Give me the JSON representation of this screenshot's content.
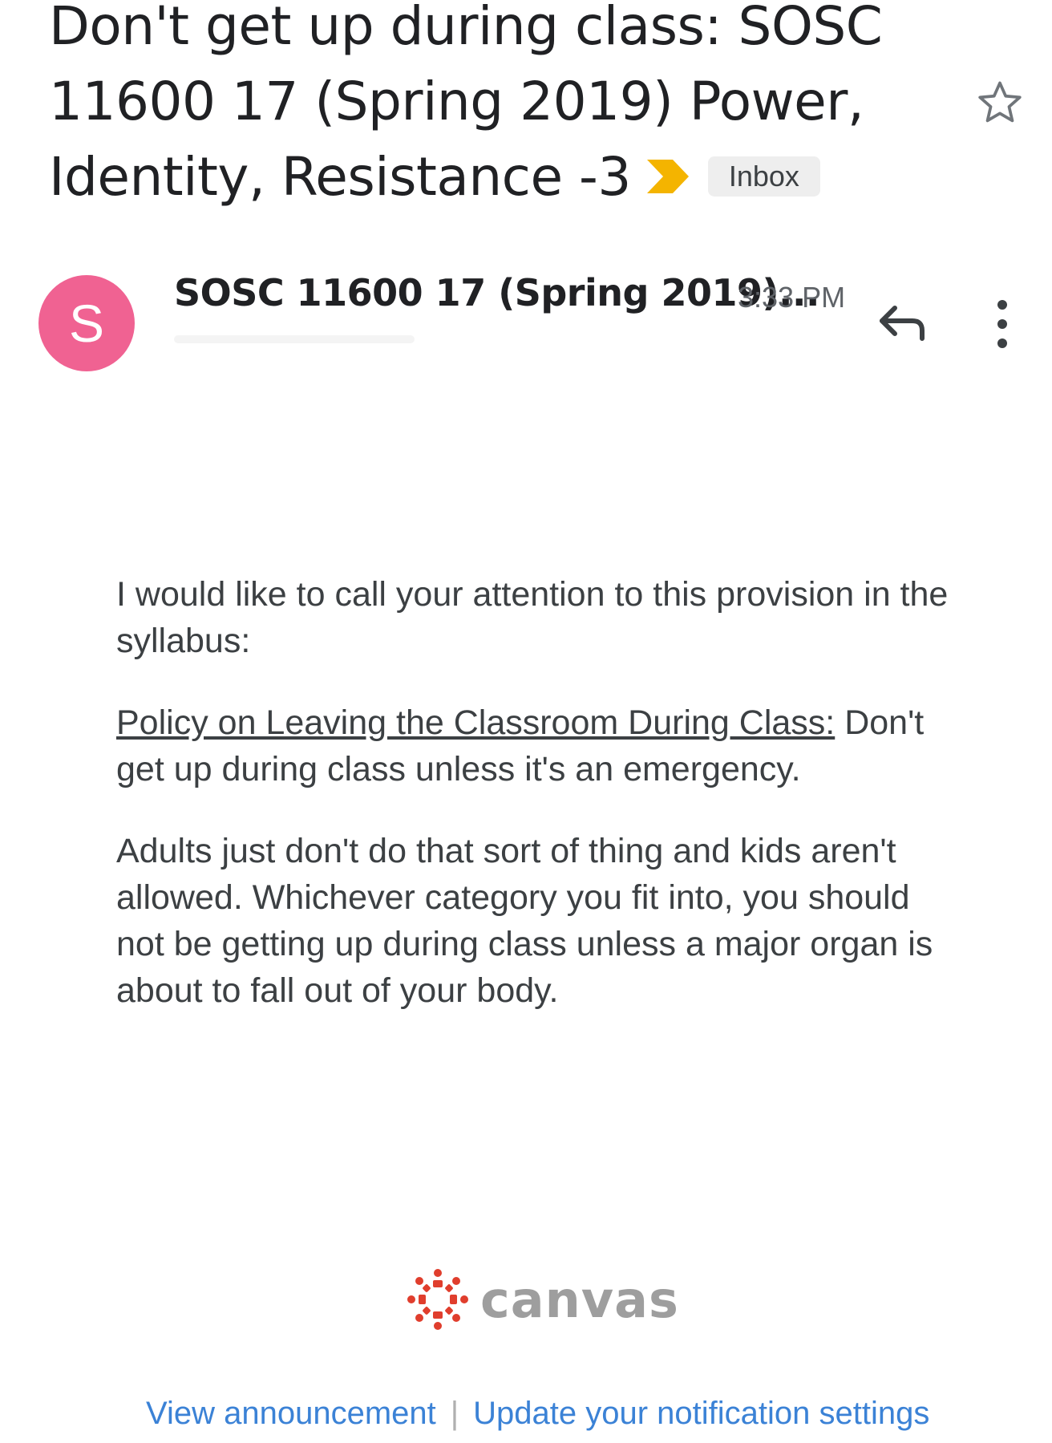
{
  "subject": {
    "text": "Don't get up during class: SOSC 11600 17 (Spring 2019) Power, Identity, Resistance -3",
    "label": "Inbox"
  },
  "icons": {
    "star": "star-outline-icon",
    "important": "importance-marker-icon",
    "reply": "reply-icon",
    "more": "more-vert-icon",
    "canvas": "canvas-logo-icon"
  },
  "colors": {
    "avatar": "#f06292",
    "important_marker": "#f4b400",
    "canvas_red": "#e03e2d",
    "link_blue": "#3b82d6"
  },
  "header": {
    "avatar_letter": "S",
    "sender": "SOSC 11600 17 (Spring 2019)...",
    "time": "3:33 PM"
  },
  "body": {
    "intro": "I would like to call your attention to this provision in the syllabus:",
    "policy_link": "Policy on Leaving the Classroom During Class:",
    "policy_text": " Don't get up during class unless it's an emergency.",
    "closing": "Adults just don't do that sort of thing and kids aren't allowed.  Whichever category you fit into, you should not be getting up during class unless a major organ is about to fall out of your body."
  },
  "footer": {
    "brand": "canvas",
    "view_link": "View announcement",
    "separator": "|",
    "settings_link": "Update your notification settings"
  }
}
